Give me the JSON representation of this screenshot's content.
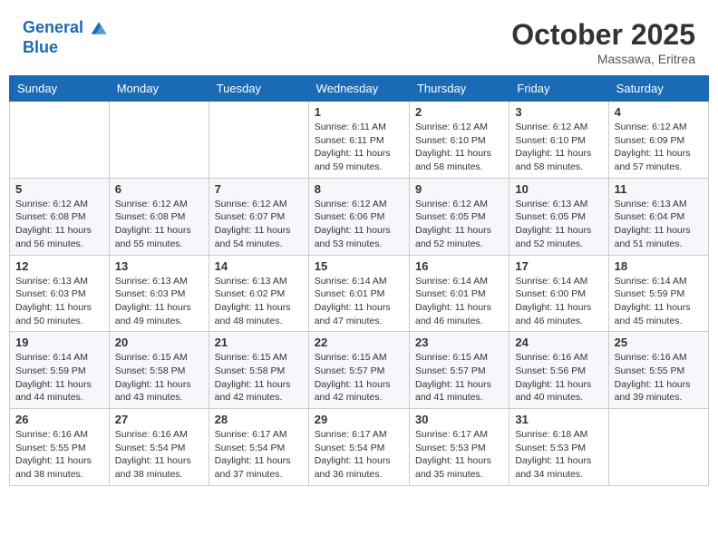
{
  "header": {
    "logo_line1": "General",
    "logo_line2": "Blue",
    "month": "October 2025",
    "location": "Massawa, Eritrea"
  },
  "weekdays": [
    "Sunday",
    "Monday",
    "Tuesday",
    "Wednesday",
    "Thursday",
    "Friday",
    "Saturday"
  ],
  "weeks": [
    [
      {
        "day": "",
        "info": ""
      },
      {
        "day": "",
        "info": ""
      },
      {
        "day": "",
        "info": ""
      },
      {
        "day": "1",
        "info": "Sunrise: 6:11 AM\nSunset: 6:11 PM\nDaylight: 11 hours\nand 59 minutes."
      },
      {
        "day": "2",
        "info": "Sunrise: 6:12 AM\nSunset: 6:10 PM\nDaylight: 11 hours\nand 58 minutes."
      },
      {
        "day": "3",
        "info": "Sunrise: 6:12 AM\nSunset: 6:10 PM\nDaylight: 11 hours\nand 58 minutes."
      },
      {
        "day": "4",
        "info": "Sunrise: 6:12 AM\nSunset: 6:09 PM\nDaylight: 11 hours\nand 57 minutes."
      }
    ],
    [
      {
        "day": "5",
        "info": "Sunrise: 6:12 AM\nSunset: 6:08 PM\nDaylight: 11 hours\nand 56 minutes."
      },
      {
        "day": "6",
        "info": "Sunrise: 6:12 AM\nSunset: 6:08 PM\nDaylight: 11 hours\nand 55 minutes."
      },
      {
        "day": "7",
        "info": "Sunrise: 6:12 AM\nSunset: 6:07 PM\nDaylight: 11 hours\nand 54 minutes."
      },
      {
        "day": "8",
        "info": "Sunrise: 6:12 AM\nSunset: 6:06 PM\nDaylight: 11 hours\nand 53 minutes."
      },
      {
        "day": "9",
        "info": "Sunrise: 6:12 AM\nSunset: 6:05 PM\nDaylight: 11 hours\nand 52 minutes."
      },
      {
        "day": "10",
        "info": "Sunrise: 6:13 AM\nSunset: 6:05 PM\nDaylight: 11 hours\nand 52 minutes."
      },
      {
        "day": "11",
        "info": "Sunrise: 6:13 AM\nSunset: 6:04 PM\nDaylight: 11 hours\nand 51 minutes."
      }
    ],
    [
      {
        "day": "12",
        "info": "Sunrise: 6:13 AM\nSunset: 6:03 PM\nDaylight: 11 hours\nand 50 minutes."
      },
      {
        "day": "13",
        "info": "Sunrise: 6:13 AM\nSunset: 6:03 PM\nDaylight: 11 hours\nand 49 minutes."
      },
      {
        "day": "14",
        "info": "Sunrise: 6:13 AM\nSunset: 6:02 PM\nDaylight: 11 hours\nand 48 minutes."
      },
      {
        "day": "15",
        "info": "Sunrise: 6:14 AM\nSunset: 6:01 PM\nDaylight: 11 hours\nand 47 minutes."
      },
      {
        "day": "16",
        "info": "Sunrise: 6:14 AM\nSunset: 6:01 PM\nDaylight: 11 hours\nand 46 minutes."
      },
      {
        "day": "17",
        "info": "Sunrise: 6:14 AM\nSunset: 6:00 PM\nDaylight: 11 hours\nand 46 minutes."
      },
      {
        "day": "18",
        "info": "Sunrise: 6:14 AM\nSunset: 5:59 PM\nDaylight: 11 hours\nand 45 minutes."
      }
    ],
    [
      {
        "day": "19",
        "info": "Sunrise: 6:14 AM\nSunset: 5:59 PM\nDaylight: 11 hours\nand 44 minutes."
      },
      {
        "day": "20",
        "info": "Sunrise: 6:15 AM\nSunset: 5:58 PM\nDaylight: 11 hours\nand 43 minutes."
      },
      {
        "day": "21",
        "info": "Sunrise: 6:15 AM\nSunset: 5:58 PM\nDaylight: 11 hours\nand 42 minutes."
      },
      {
        "day": "22",
        "info": "Sunrise: 6:15 AM\nSunset: 5:57 PM\nDaylight: 11 hours\nand 42 minutes."
      },
      {
        "day": "23",
        "info": "Sunrise: 6:15 AM\nSunset: 5:57 PM\nDaylight: 11 hours\nand 41 minutes."
      },
      {
        "day": "24",
        "info": "Sunrise: 6:16 AM\nSunset: 5:56 PM\nDaylight: 11 hours\nand 40 minutes."
      },
      {
        "day": "25",
        "info": "Sunrise: 6:16 AM\nSunset: 5:55 PM\nDaylight: 11 hours\nand 39 minutes."
      }
    ],
    [
      {
        "day": "26",
        "info": "Sunrise: 6:16 AM\nSunset: 5:55 PM\nDaylight: 11 hours\nand 38 minutes."
      },
      {
        "day": "27",
        "info": "Sunrise: 6:16 AM\nSunset: 5:54 PM\nDaylight: 11 hours\nand 38 minutes."
      },
      {
        "day": "28",
        "info": "Sunrise: 6:17 AM\nSunset: 5:54 PM\nDaylight: 11 hours\nand 37 minutes."
      },
      {
        "day": "29",
        "info": "Sunrise: 6:17 AM\nSunset: 5:54 PM\nDaylight: 11 hours\nand 36 minutes."
      },
      {
        "day": "30",
        "info": "Sunrise: 6:17 AM\nSunset: 5:53 PM\nDaylight: 11 hours\nand 35 minutes."
      },
      {
        "day": "31",
        "info": "Sunrise: 6:18 AM\nSunset: 5:53 PM\nDaylight: 11 hours\nand 34 minutes."
      },
      {
        "day": "",
        "info": ""
      }
    ]
  ]
}
